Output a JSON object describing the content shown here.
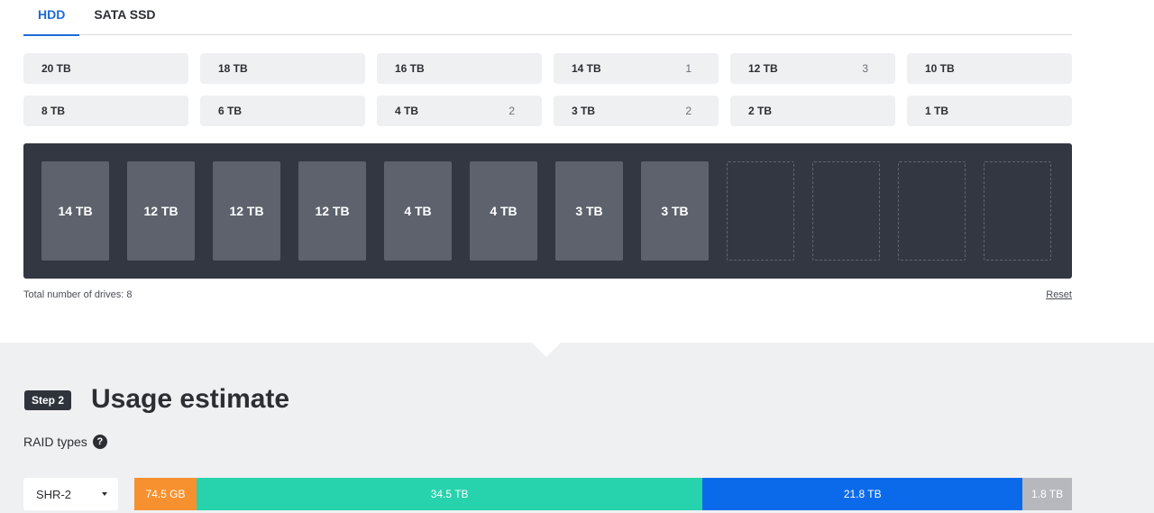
{
  "tabs": [
    {
      "label": "HDD",
      "active": true
    },
    {
      "label": "SATA SSD",
      "active": false
    }
  ],
  "capacities": [
    {
      "label": "20 TB",
      "count": ""
    },
    {
      "label": "18 TB",
      "count": ""
    },
    {
      "label": "16 TB",
      "count": ""
    },
    {
      "label": "14 TB",
      "count": "1"
    },
    {
      "label": "12 TB",
      "count": "3"
    },
    {
      "label": "10 TB",
      "count": ""
    },
    {
      "label": "8 TB",
      "count": ""
    },
    {
      "label": "6 TB",
      "count": ""
    },
    {
      "label": "4 TB",
      "count": "2"
    },
    {
      "label": "3 TB",
      "count": "2"
    },
    {
      "label": "2 TB",
      "count": ""
    },
    {
      "label": "1 TB",
      "count": ""
    }
  ],
  "bay": {
    "slots": [
      "14 TB",
      "12 TB",
      "12 TB",
      "12 TB",
      "4 TB",
      "4 TB",
      "3 TB",
      "3 TB",
      "",
      "",
      "",
      ""
    ]
  },
  "summary": {
    "total_text": "Total number of drives: 8",
    "reset_label": "Reset"
  },
  "step2": {
    "badge": "Step 2",
    "title": "Usage estimate",
    "raid_label": "RAID types",
    "help_icon": "question-circle-icon",
    "raid_selected": "SHR-2"
  },
  "usage": {
    "segments": [
      {
        "label": "74.5 GB",
        "fraction": 0.066,
        "color": "#f7912f"
      },
      {
        "label": "34.5 TB",
        "fraction": 0.54,
        "color": "#26d3ac"
      },
      {
        "label": "21.8 TB",
        "fraction": 0.341,
        "color": "#0b6aea"
      },
      {
        "label": "1.8 TB",
        "fraction": 0.053,
        "color": "#b6b8bd"
      }
    ]
  }
}
